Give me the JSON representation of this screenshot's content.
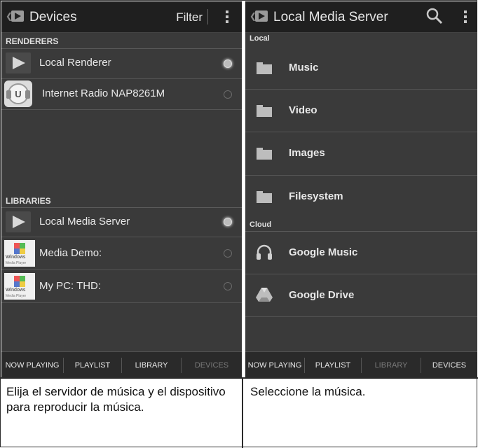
{
  "left": {
    "title": "Devices",
    "filter_label": "Filter",
    "renderers_header": "RENDERERS",
    "renderers": [
      {
        "label": "Local Renderer",
        "selected": true
      },
      {
        "label": "Internet Radio NAP8261M",
        "selected": false
      }
    ],
    "libraries_header": "LIBRARIES",
    "libraries": [
      {
        "label": "Local Media Server",
        "selected": true
      },
      {
        "label": "Media Demo:",
        "selected": false
      },
      {
        "label": "My PC:  THD:",
        "selected": false
      }
    ],
    "windows_icon_text": "Windows",
    "windows_icon_sub": "Media Player",
    "radio_icon_letter": "U",
    "tabs": [
      {
        "label": "NOW PLAYING",
        "active": true
      },
      {
        "label": "PLAYLIST",
        "active": true
      },
      {
        "label": "LIBRARY",
        "active": true
      },
      {
        "label": "DEVICES",
        "active": false
      }
    ]
  },
  "right": {
    "title": "Local Media Server",
    "local_header": "Local",
    "local_items": [
      "Music",
      "Video",
      "Images",
      "Filesystem"
    ],
    "cloud_header": "Cloud",
    "cloud_items": [
      "Google Music",
      "Google Drive"
    ],
    "tabs": [
      {
        "label": "NOW PLAYING",
        "active": true
      },
      {
        "label": "PLAYLIST",
        "active": true
      },
      {
        "label": "LIBRARY",
        "active": false
      },
      {
        "label": "DEVICES",
        "active": true
      }
    ]
  },
  "captions": {
    "left": "Elija el servidor de música y el dispositivo para reproducir la música.",
    "right": "Seleccione la música."
  },
  "colors": {
    "panel_bg": "#3a3a3a",
    "actionbar_bg": "#1f1f1f",
    "text_light": "#e8e8e8",
    "text_dim": "#7a7a7a"
  }
}
